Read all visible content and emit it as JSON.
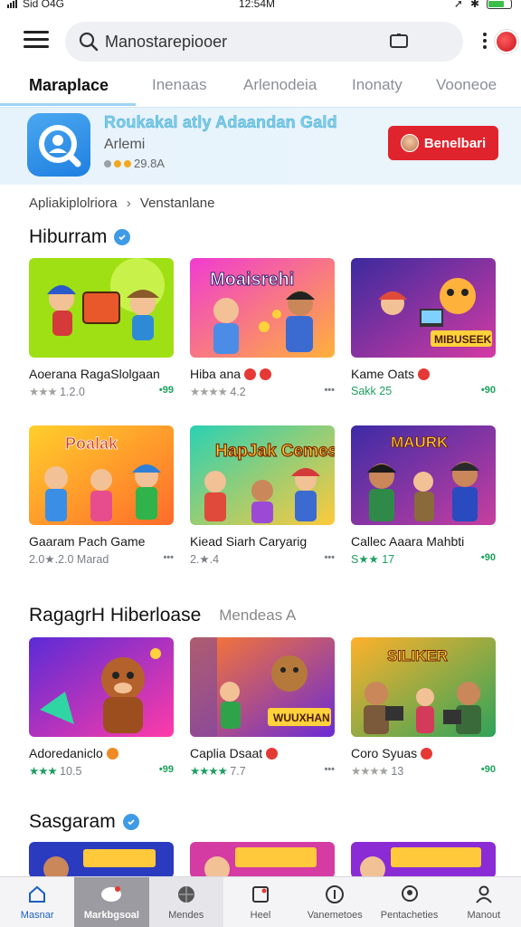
{
  "status": {
    "carrier": "Sid O4G",
    "time": "12:54M"
  },
  "search": {
    "placeholder": "Manostarepiooer"
  },
  "tabs": [
    {
      "label": "Maraplace"
    },
    {
      "label": "Inenaas"
    },
    {
      "label": "Arlenodeia"
    },
    {
      "label": "Inonaty"
    },
    {
      "label": "Vooneoe"
    }
  ],
  "banner": {
    "title": "Roukakal atly Adaandan Gald",
    "subtitle": "Arlemi",
    "rating": "29.8A",
    "button": "Benelbari"
  },
  "breadcrumb": {
    "part1": "Apliakiplolriora",
    "sep": "›",
    "part2": "Venstanlane"
  },
  "sections": [
    {
      "title": "Hiburram",
      "subtitle": "",
      "items": [
        {
          "name": "Aoerana RagaSlolgaan",
          "rating": "1.2.0",
          "price": "•99"
        },
        {
          "name": "Hiba ana",
          "rating": "4.2",
          "price": "•••"
        },
        {
          "name": "Kame Oats",
          "rating": "Sakk 25",
          "price": "•90"
        }
      ]
    },
    {
      "title": "",
      "subtitle": "",
      "items": [
        {
          "name": "Gaaram Pach Game",
          "rating": "2.0★.2.0 Marad",
          "price": "•••"
        },
        {
          "name": "Kiead Siarh Caryarig",
          "rating": "2.★.4",
          "price": "•••"
        },
        {
          "name": "Callec Aaara Mahbti",
          "rating": "S★★ 17",
          "price": "•90"
        }
      ]
    },
    {
      "title": "RagagrH Hiberloase",
      "subtitle": "Mendeas A",
      "items": [
        {
          "name": "Adoredaniclo",
          "rating": "10.5",
          "price": "•99"
        },
        {
          "name": "Caplia Dsaat",
          "rating": "7.7",
          "price": "•••"
        },
        {
          "name": "Coro Syuas",
          "rating": "13",
          "price": "•90"
        }
      ]
    },
    {
      "title": "Sasgaram",
      "subtitle": "",
      "items": []
    }
  ],
  "thumbs": {
    "t2": "Moaisrehi",
    "t3": "MIBUSEEK",
    "t4": "Poalak",
    "t5": "HapJak Cemes",
    "t6": "MAURK",
    "t8": "WUUXHAN",
    "t9": "SILIKER"
  },
  "bottom_nav": [
    {
      "label": "Masnar"
    },
    {
      "label": "Markbgsoal"
    },
    {
      "label": "Mendes"
    },
    {
      "label": "Heel"
    },
    {
      "label": "Vanemetoes"
    },
    {
      "label": "Pentacheties"
    },
    {
      "label": "Manout"
    }
  ]
}
